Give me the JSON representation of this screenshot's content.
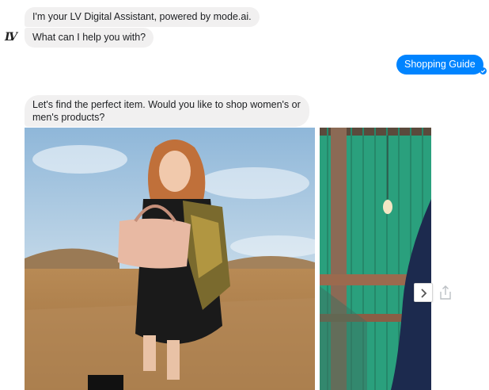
{
  "messages": {
    "bot_intro": "I'm your LV Digital Assistant, powered by mode.ai.",
    "bot_question": "What can I help you with?",
    "user_reply": "Shopping Guide",
    "bot_prompt": "Let's find the perfect item. Would you like to shop women's or men's products?"
  },
  "avatar": {
    "monogram": "LV"
  },
  "colors": {
    "user_bubble": "#0084ff",
    "bot_bubble": "#f1f0f0",
    "text": "#1c1e21"
  },
  "icons": {
    "delivered": "check-circle-icon",
    "next": "chevron-right-icon",
    "share": "share-icon"
  }
}
